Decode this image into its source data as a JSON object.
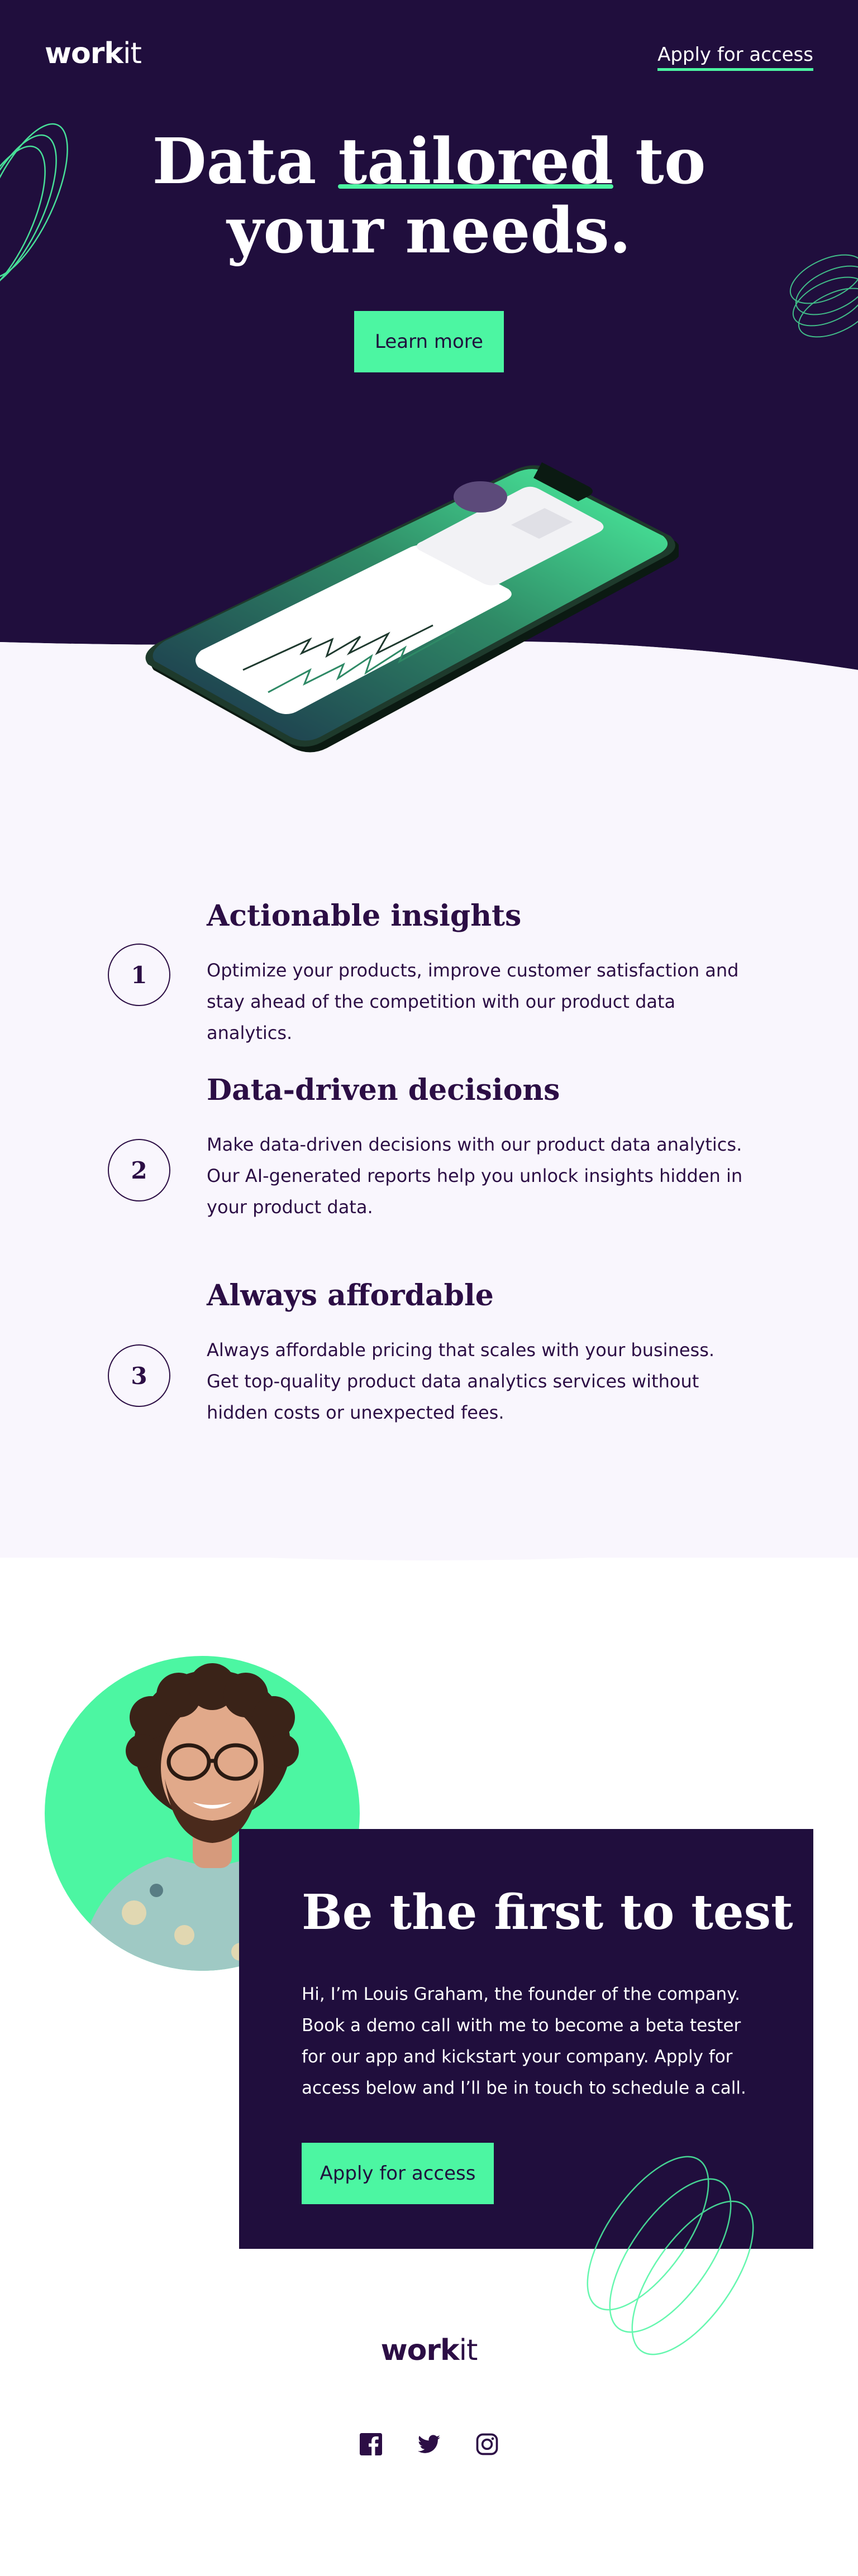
{
  "header": {
    "logo_bold": "work",
    "logo_light": "it",
    "nav_link": "Apply for access"
  },
  "hero": {
    "title_before": "Data ",
    "title_highlight": "tailored",
    "title_after_line1": " to",
    "title_line2": "your needs.",
    "button": "Learn more"
  },
  "features": [
    {
      "number": "1",
      "title": "Actionable insights",
      "text": "Optimize your products, improve customer satisfaction and stay ahead of the competition with our product data analytics."
    },
    {
      "number": "2",
      "title": "Data-driven decisions",
      "text": "Make data-driven decisions with our product data analytics. Our AI-generated reports help you unlock insights hidden in your product data."
    },
    {
      "number": "3",
      "title": "Always affordable",
      "text": "Always affordable pricing that scales with your business. Get top-quality product data analytics services without hidden costs or unexpected fees."
    }
  ],
  "cta": {
    "title": "Be the first to test",
    "text": "Hi, I’m Louis Graham, the founder of the company. Book a demo call with me to become a beta tester for our app and kickstart your company. Apply for access below and I’ll be in touch to schedule a call.",
    "button": "Apply for access"
  },
  "footer": {
    "logo_bold": "work",
    "logo_light": "it",
    "socials": [
      "facebook-icon",
      "twitter-icon",
      "instagram-icon"
    ]
  },
  "colors": {
    "dark_purple": "#200e3d",
    "accent_green": "#4cf6a2",
    "light_bg": "#f9f6fd",
    "text_dark": "#2c0e45"
  }
}
